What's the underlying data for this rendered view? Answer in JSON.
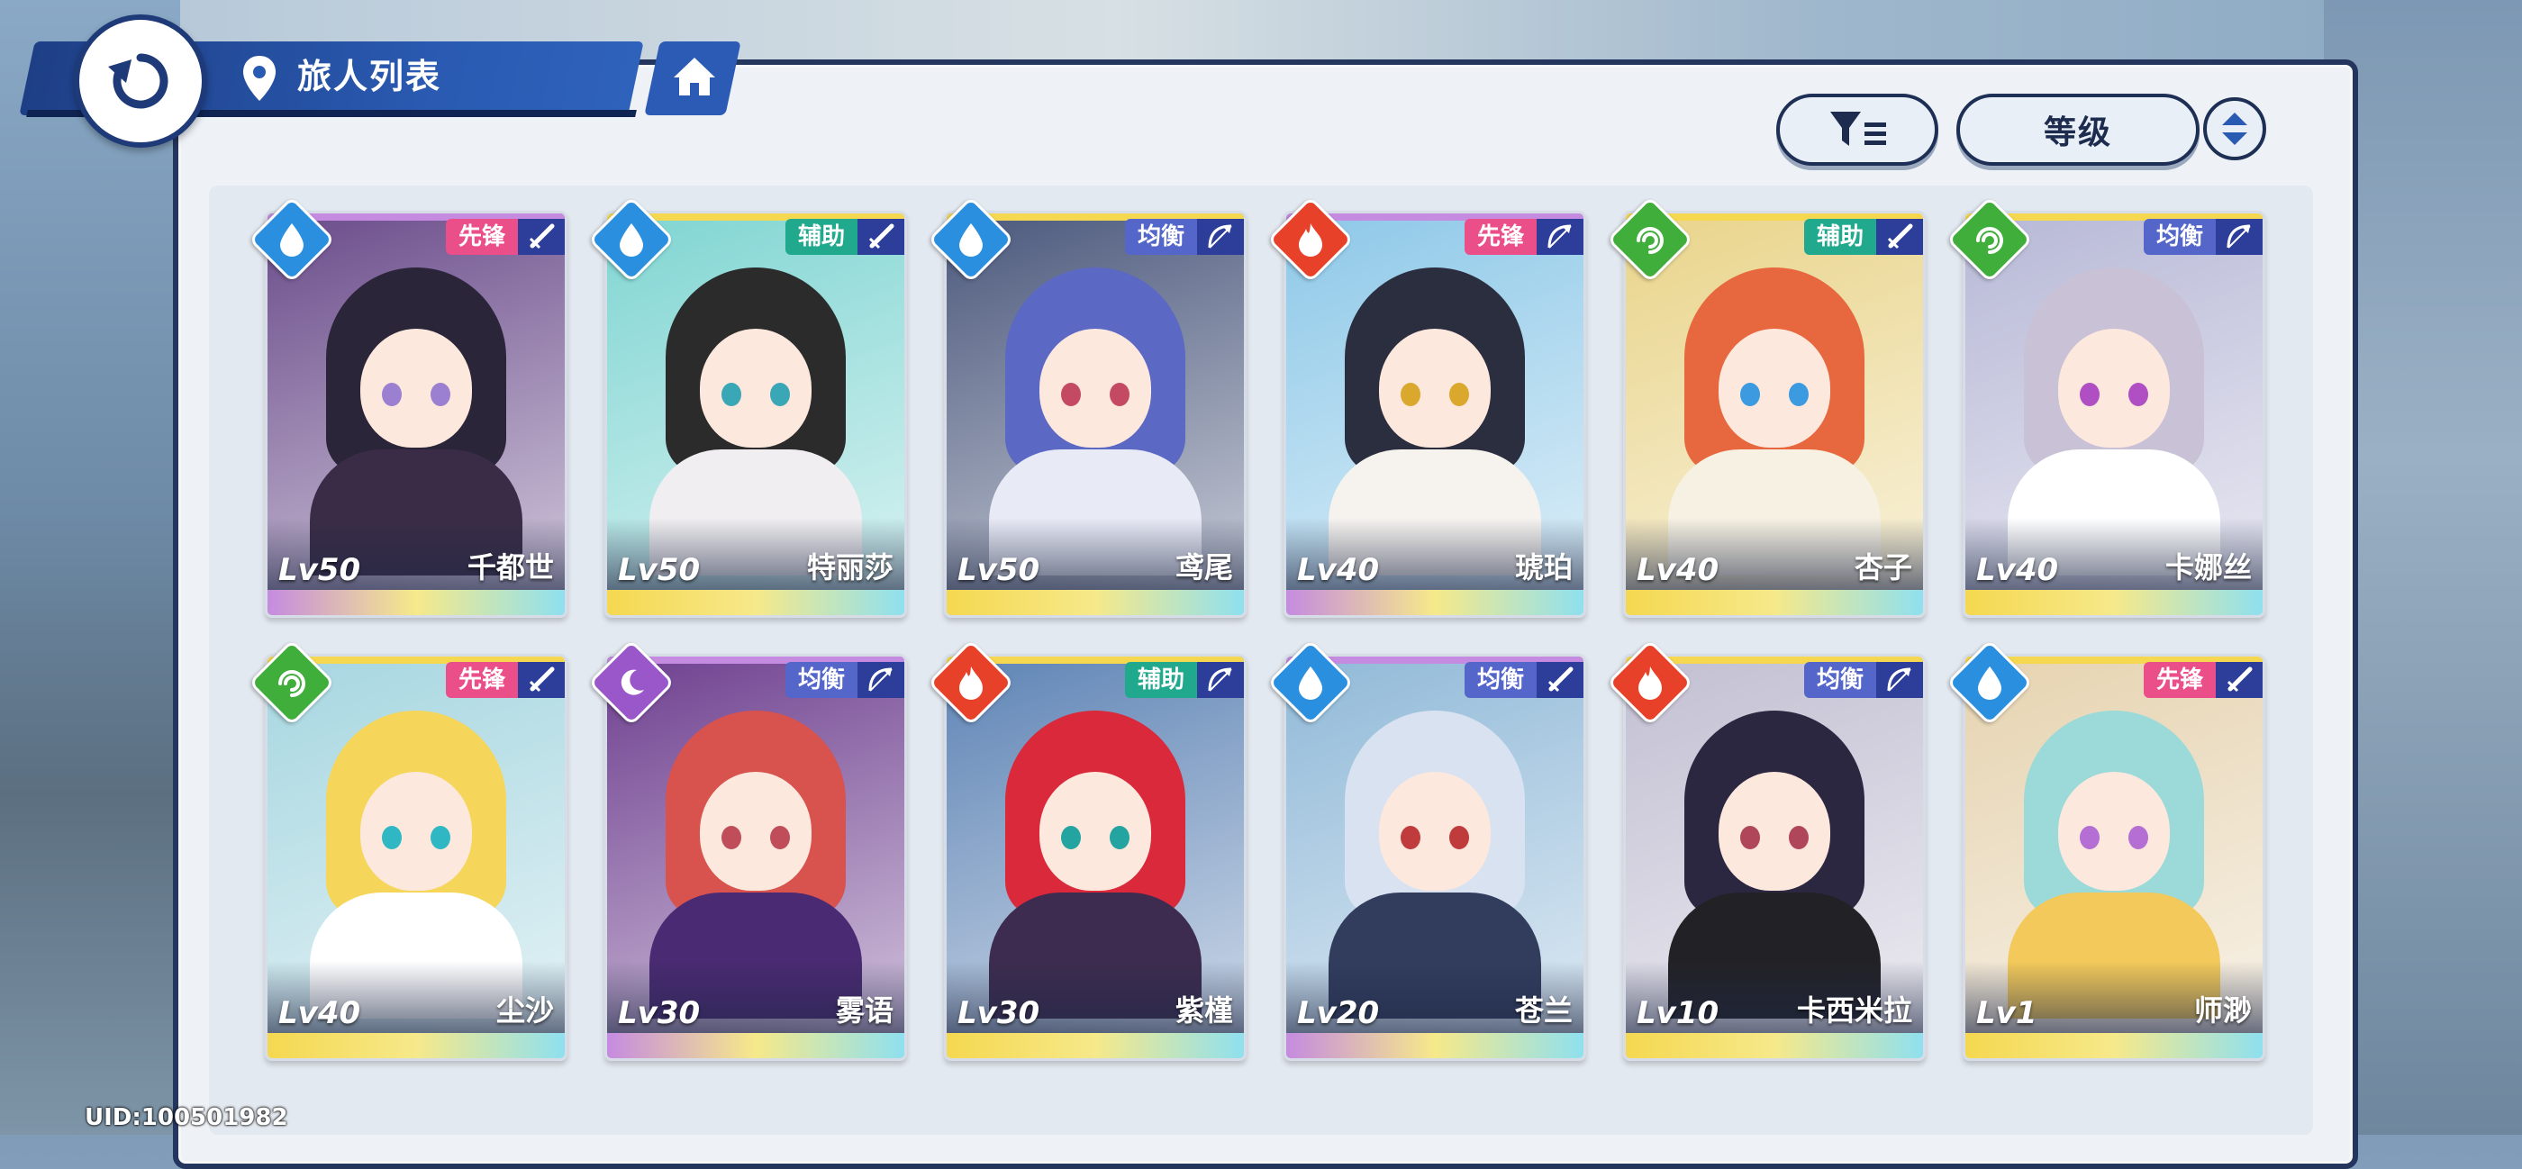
{
  "header": {
    "title": "旅人列表"
  },
  "toolbar": {
    "sort_label": "等级"
  },
  "footer": {
    "uid": "UID:100501982"
  },
  "colors": {
    "water": "#2b8fe0",
    "fire": "#e8412a",
    "wind": "#3fae3a",
    "dark": "#9a57c9",
    "vanguard": "#ea4f89",
    "support": "#21a98e",
    "balance": "#5466c9"
  },
  "characters": [
    {
      "level": "Lv50",
      "name": "千都世",
      "role": "先锋",
      "element": "water",
      "weapon": "sword",
      "hair": "#2a2538",
      "outfit": "#3a2c46",
      "eye": "#9b7fd1",
      "bg": "#6a4b8a",
      "strip": "#c58be0"
    },
    {
      "level": "Lv50",
      "name": "特丽莎",
      "role": "辅助",
      "element": "water",
      "weapon": "sword",
      "hair": "#2b2b2c",
      "outfit": "#f0eef0",
      "eye": "#3aa7b7",
      "bg": "#7fd5d2",
      "strip": "#f5d850"
    },
    {
      "level": "Lv50",
      "name": "鸢尾",
      "role": "均衡",
      "element": "water",
      "weapon": "bow",
      "hair": "#5b68c4",
      "outfit": "#e8eaf5",
      "eye": "#c44a63",
      "bg": "#4b587c",
      "strip": "#f5d850"
    },
    {
      "level": "Lv40",
      "name": "琥珀",
      "role": "先锋",
      "element": "fire",
      "weapon": "bow",
      "hair": "#2b2e3f",
      "outfit": "#f6f3ef",
      "eye": "#d9a82c",
      "bg": "#8dc8e8",
      "strip": "#c58be0"
    },
    {
      "level": "Lv40",
      "name": "杏子",
      "role": "辅助",
      "element": "wind",
      "weapon": "sword",
      "hair": "#e7683e",
      "outfit": "#f6f1e2",
      "eye": "#3c9be0",
      "bg": "#e9d48a",
      "strip": "#f5d850"
    },
    {
      "level": "Lv40",
      "name": "卡娜丝",
      "role": "均衡",
      "element": "wind",
      "weapon": "bow",
      "hair": "#c9c1d6",
      "outfit": "#ffffff",
      "eye": "#b04ec4",
      "bg": "#b7b8d6",
      "strip": "#f5d850"
    },
    {
      "level": "Lv40",
      "name": "尘沙",
      "role": "先锋",
      "element": "wind",
      "weapon": "sword",
      "hair": "#f5d55a",
      "outfit": "#ffffff",
      "eye": "#2fb8c4",
      "bg": "#a6d6e0",
      "strip": "#f5d850"
    },
    {
      "level": "Lv30",
      "name": "雾语",
      "role": "均衡",
      "element": "dark",
      "weapon": "bow",
      "hair": "#d8524e",
      "outfit": "#4a2a72",
      "eye": "#c04e5a",
      "bg": "#6e3f8f",
      "strip": "#c58be0"
    },
    {
      "level": "Lv30",
      "name": "紫槿",
      "role": "辅助",
      "element": "fire",
      "weapon": "bow",
      "hair": "#d9293b",
      "outfit": "#3d2c4f",
      "eye": "#23a4a0",
      "bg": "#5e84b5",
      "strip": "#f5d850"
    },
    {
      "level": "Lv20",
      "name": "苍兰",
      "role": "均衡",
      "element": "water",
      "weapon": "sword",
      "hair": "#d8e2f0",
      "outfit": "#323d5e",
      "eye": "#c03b3b",
      "bg": "#90b9d8",
      "strip": "#c58be0"
    },
    {
      "level": "Lv10",
      "name": "卡西米拉",
      "role": "均衡",
      "element": "fire",
      "weapon": "bow",
      "hair": "#2b2740",
      "outfit": "#222226",
      "eye": "#b0465a",
      "bg": "#c2bfd2",
      "strip": "#f5d850"
    },
    {
      "level": "Lv1",
      "name": "师渺",
      "role": "先锋",
      "element": "water",
      "weapon": "sword",
      "hair": "#9bdad9",
      "outfit": "#f2c95a",
      "eye": "#b56ed4",
      "bg": "#e6d3b0",
      "strip": "#f5d850"
    }
  ]
}
